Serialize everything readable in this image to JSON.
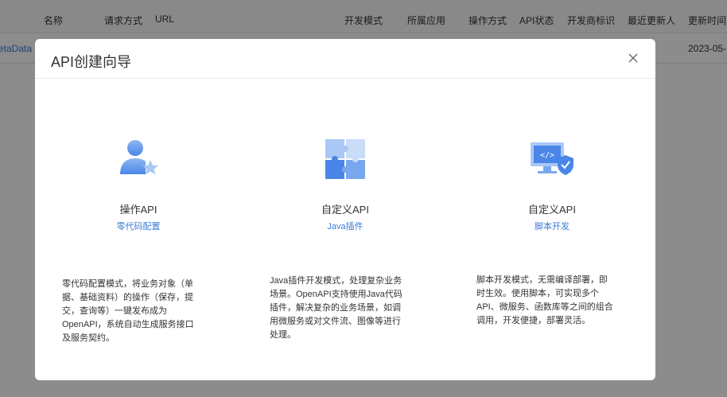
{
  "table": {
    "headers": [
      "名称",
      "请求方式",
      "URL",
      "开发模式",
      "所属应用",
      "操作方式",
      "API状态",
      "开发商标识",
      "最近更新人",
      "更新时间"
    ],
    "row": {
      "name_fragment": "etaData",
      "updated_fragment": "2023-05-"
    }
  },
  "modal": {
    "title": "API创建向导",
    "close_icon": "close-icon",
    "cards": [
      {
        "icon": "user-star-icon",
        "title": "操作API",
        "subtitle": "零代码配置",
        "description": "零代码配置模式，将业务对象（单\n据、基础资料）的操作（保存，提\n交，查询等）一键发布成为\nOpenAPI，系统自动生成服务接口\n及服务契约。"
      },
      {
        "icon": "puzzle-icon",
        "title": "自定义API",
        "subtitle": "Java插件",
        "description": "Java插件开发模式，处理复杂业务\n场景。OpenAPI支持使用Java代码\n插件，解决复杂的业务场景，如调\n用微服务或对文件流、图像等进行\n处理。"
      },
      {
        "icon": "code-monitor-shield-icon",
        "title": "自定义API",
        "subtitle": "脚本开发",
        "description": "脚本开发模式，无需编译部署，即\n时生效。使用脚本，可实现多个\nAPI、微服务、函数库等之间的组合\n调用，开发便捷，部署灵活。"
      }
    ]
  },
  "colors": {
    "accent": "#3a7bd5",
    "icon_light": "#a9c8f5",
    "icon_dark": "#4a86e8"
  }
}
